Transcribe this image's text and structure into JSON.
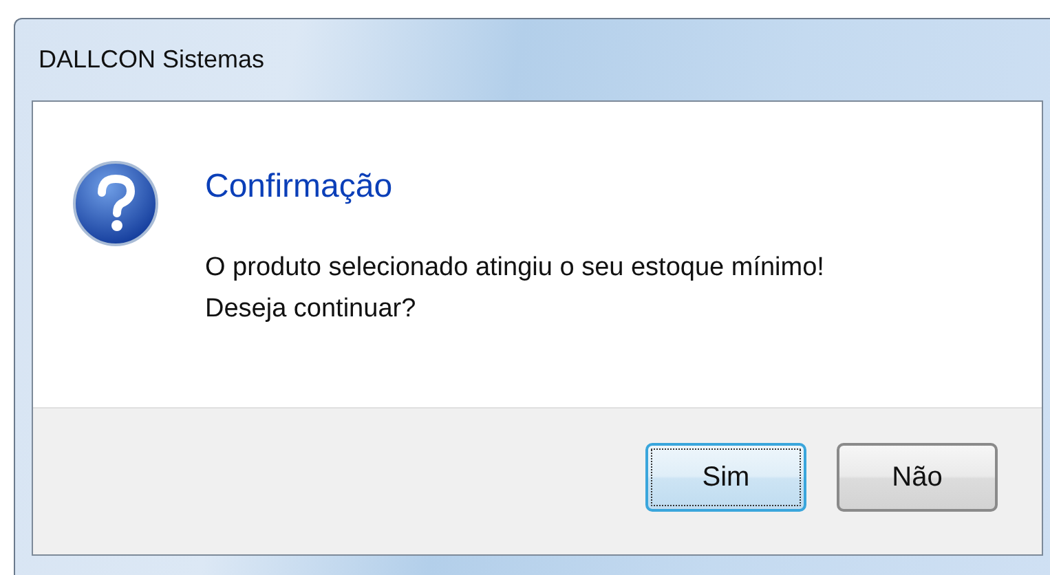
{
  "window": {
    "title": "DALLCON Sistemas"
  },
  "dialog": {
    "heading": "Confirmação",
    "message": "O produto selecionado atingiu o seu estoque mínimo! Deseja continuar?"
  },
  "buttons": [
    {
      "label": "Sim",
      "focused": true
    },
    {
      "label": "Não",
      "focused": false
    }
  ]
}
